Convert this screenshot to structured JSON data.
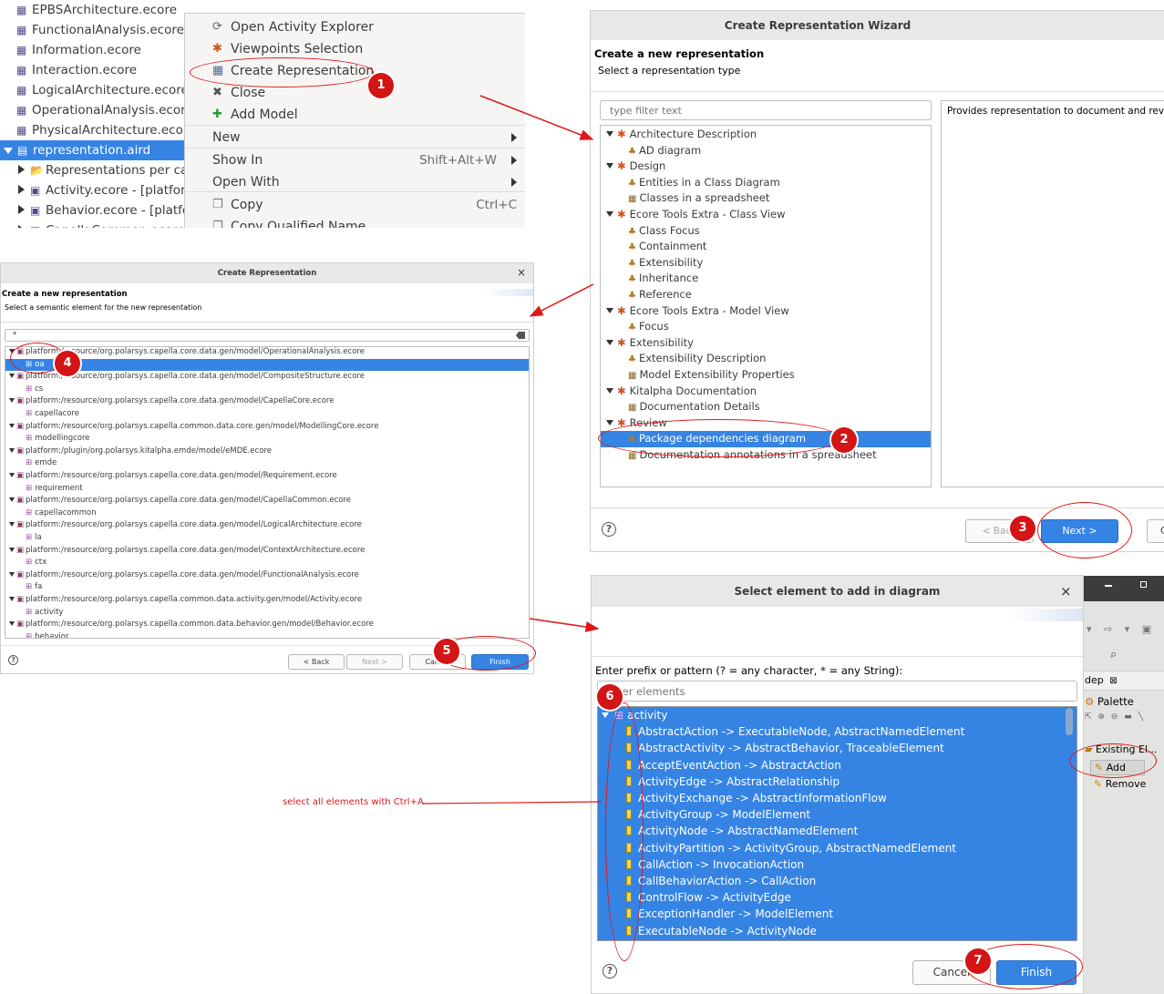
{
  "project_tree": {
    "items": [
      {
        "label": "EPBSArchitecture.ecore",
        "icon": "ecore-file-icon"
      },
      {
        "label": "FunctionalAnalysis.ecore",
        "icon": "ecore-file-icon"
      },
      {
        "label": "Information.ecore",
        "icon": "ecore-file-icon"
      },
      {
        "label": "Interaction.ecore",
        "icon": "ecore-file-icon"
      },
      {
        "label": "LogicalArchitecture.ecore",
        "icon": "ecore-file-icon"
      },
      {
        "label": "OperationalAnalysis.ecore",
        "icon": "ecore-file-icon"
      },
      {
        "label": "PhysicalArchitecture.ecore",
        "icon": "ecore-file-icon"
      },
      {
        "label": "representation.aird",
        "icon": "aird-file-icon",
        "selected": true
      },
      {
        "label": "Representations per cat",
        "icon": "folder-icon"
      },
      {
        "label": "Activity.ecore - [platfor",
        "icon": "resource-icon"
      },
      {
        "label": "Behavior.ecore - [platfor",
        "icon": "resource-icon"
      },
      {
        "label": "CapellaCommon.ecore",
        "icon": "resource-icon"
      }
    ]
  },
  "context_menu": {
    "items": [
      {
        "label": "Open Activity Explorer",
        "icon": "activity-explorer-icon"
      },
      {
        "label": "Viewpoints Selection",
        "icon": "viewpoint-icon"
      },
      {
        "label": "Create Representation",
        "icon": "create-representation-icon"
      },
      {
        "label": "Close",
        "icon": "close-icon"
      },
      {
        "label": "Add Model",
        "icon": "add-icon"
      },
      {
        "label": "New",
        "submenu": true
      },
      {
        "label": "Show In",
        "accel": "Shift+Alt+W",
        "submenu": true
      },
      {
        "label": "Open With",
        "submenu": true
      },
      {
        "label": "Copy",
        "accel": "Ctrl+C",
        "icon": "copy-icon"
      },
      {
        "label": "Copy Qualified Name",
        "icon": "copy-icon"
      }
    ]
  },
  "wizard": {
    "title": "Create Representation Wizard",
    "heading": "Create a new representation",
    "subheading": "Select a representation type",
    "filter_placeholder": "type filter text",
    "description": "Provides representation to document and review",
    "tree": [
      {
        "label": "Architecture Description",
        "level": 0
      },
      {
        "label": "AD diagram",
        "level": 1,
        "kind": "diagram"
      },
      {
        "label": "Design",
        "level": 0
      },
      {
        "label": "Entities in a Class Diagram",
        "level": 1,
        "kind": "diagram"
      },
      {
        "label": "Classes in a spreadsheet",
        "level": 1,
        "kind": "table"
      },
      {
        "label": "Ecore Tools Extra - Class View",
        "level": 0
      },
      {
        "label": "Class Focus",
        "level": 1,
        "kind": "diagram"
      },
      {
        "label": "Containment",
        "level": 1,
        "kind": "diagram"
      },
      {
        "label": "Extensibility",
        "level": 1,
        "kind": "diagram"
      },
      {
        "label": "Inheritance",
        "level": 1,
        "kind": "diagram"
      },
      {
        "label": "Reference",
        "level": 1,
        "kind": "diagram"
      },
      {
        "label": "Ecore Tools Extra - Model View",
        "level": 0
      },
      {
        "label": "Focus",
        "level": 1,
        "kind": "diagram"
      },
      {
        "label": "Extensibility",
        "level": 0
      },
      {
        "label": "Extensibility Description",
        "level": 1,
        "kind": "diagram"
      },
      {
        "label": "Model Extensibility Properties",
        "level": 1,
        "kind": "table"
      },
      {
        "label": "Kitalpha Documentation",
        "level": 0
      },
      {
        "label": "Documentation Details",
        "level": 1,
        "kind": "table"
      },
      {
        "label": "Review",
        "level": 0
      },
      {
        "label": "Package dependencies diagram",
        "level": 1,
        "kind": "diagram",
        "selected": true
      },
      {
        "label": "Documentation annotations in a spreadsheet",
        "level": 1,
        "kind": "table"
      }
    ],
    "back_label": "< Back",
    "next_label": "Next >",
    "cancel_label": "Cancel"
  },
  "create_rep": {
    "title": "Create Representation",
    "close_glyph": "×",
    "heading": "Create a new representation",
    "subheading": "Select a semantic element for the new representation",
    "filter_value": "*",
    "tree": [
      {
        "label": "platform:/resource/org.polarsys.capella.core.data.gen/model/OperationalAnalysis.ecore",
        "level": 0
      },
      {
        "label": "oa",
        "level": 1,
        "selected": true
      },
      {
        "label": "platform:/resource/org.polarsys.capella.core.data.gen/model/CompositeStructure.ecore",
        "level": 0
      },
      {
        "label": "cs",
        "level": 1
      },
      {
        "label": "platform:/resource/org.polarsys.capella.core.data.gen/model/CapellaCore.ecore",
        "level": 0
      },
      {
        "label": "capellacore",
        "level": 1
      },
      {
        "label": "platform:/resource/org.polarsys.capella.common.data.core.gen/model/ModellingCore.ecore",
        "level": 0
      },
      {
        "label": "modellingcore",
        "level": 1
      },
      {
        "label": "platform:/plugin/org.polarsys.kitalpha.emde/model/eMDE.ecore",
        "level": 0
      },
      {
        "label": "emde",
        "level": 1
      },
      {
        "label": "platform:/resource/org.polarsys.capella.core.data.gen/model/Requirement.ecore",
        "level": 0
      },
      {
        "label": "requirement",
        "level": 1
      },
      {
        "label": "platform:/resource/org.polarsys.capella.core.data.gen/model/CapellaCommon.ecore",
        "level": 0
      },
      {
        "label": "capellacommon",
        "level": 1
      },
      {
        "label": "platform:/resource/org.polarsys.capella.core.data.gen/model/LogicalArchitecture.ecore",
        "level": 0
      },
      {
        "label": "la",
        "level": 1
      },
      {
        "label": "platform:/resource/org.polarsys.capella.core.data.gen/model/ContextArchitecture.ecore",
        "level": 0
      },
      {
        "label": "ctx",
        "level": 1
      },
      {
        "label": "platform:/resource/org.polarsys.capella.core.data.gen/model/FunctionalAnalysis.ecore",
        "level": 0
      },
      {
        "label": "fa",
        "level": 1
      },
      {
        "label": "platform:/resource/org.polarsys.capella.common.data.activity.gen/model/Activity.ecore",
        "level": 0
      },
      {
        "label": "activity",
        "level": 1
      },
      {
        "label": "platform:/resource/org.polarsys.capella.common.data.behavior.gen/model/Behavior.ecore",
        "level": 0
      },
      {
        "label": "behavior",
        "level": 1
      }
    ],
    "back_label": "< Back",
    "next_label": "Next >",
    "cancel_label": "Cancel",
    "finish_label": "Finish"
  },
  "select_dialog": {
    "title": "Select element to add in diagram",
    "close_glyph": "×",
    "prompt": "Enter prefix or pattern (? = any character, * = any String):",
    "filter_placeholder": "Filter elements",
    "root": "activity",
    "items": [
      "AbstractAction -> ExecutableNode, AbstractNamedElement",
      "AbstractActivity -> AbstractBehavior, TraceableElement",
      "AcceptEventAction -> AbstractAction",
      "ActivityEdge -> AbstractRelationship",
      "ActivityExchange -> AbstractInformationFlow",
      "ActivityGroup -> ModelElement",
      "ActivityNode -> AbstractNamedElement",
      "ActivityPartition -> ActivityGroup, AbstractNamedElement",
      "CallAction -> InvocationAction",
      "CallBehaviorAction -> CallAction",
      "ControlFlow -> ActivityEdge",
      "ExceptionHandler -> ModelElement",
      "ExecutableNode -> ActivityNode"
    ],
    "cancel_label": "Cancel",
    "finish_label": "Finish"
  },
  "palette_panel": {
    "tab_label": "dep",
    "tab_close": "⊠",
    "palette_label": "Palette",
    "existing_label": "Existing El...",
    "add_label": "Add",
    "remove_label": "Remove"
  },
  "annotations": {
    "badges": [
      "1",
      "2",
      "3",
      "4",
      "5",
      "6",
      "7"
    ],
    "note": "select all elements with Ctrl+A",
    "accent_color": "#d31515"
  }
}
